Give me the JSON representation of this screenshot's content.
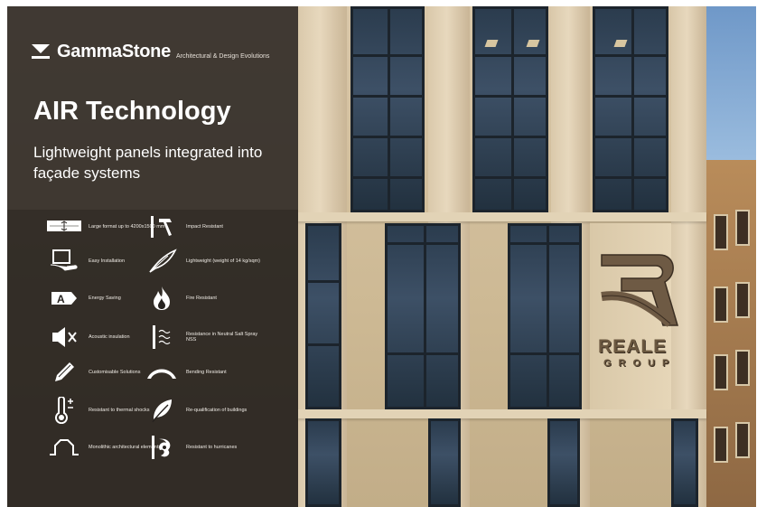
{
  "brand": {
    "name": "GammaStone",
    "tagline": "Architectural & Design Evolutions"
  },
  "headline": {
    "title": "AIR Technology",
    "subtitle": "Lightweight panels integrated into façade systems"
  },
  "features": [
    {
      "icon": "large-format-icon",
      "label": "Large format up to 4200x1500 mm"
    },
    {
      "icon": "hammer-icon",
      "label": "Impact Resistant"
    },
    {
      "icon": "laptop-hand-icon",
      "label": "Easy Installation"
    },
    {
      "icon": "feather-icon",
      "label": "Lightweight (weight of 14 kg/sqm)"
    },
    {
      "icon": "energy-a-icon",
      "label": "Energy Saving"
    },
    {
      "icon": "fire-icon",
      "label": "Fire Resistant"
    },
    {
      "icon": "speaker-mute-icon",
      "label": "Acoustic insulation"
    },
    {
      "icon": "salt-spray-icon",
      "label": "Resistance in Neutral Salt Spray NSS"
    },
    {
      "icon": "pencil-icon",
      "label": "Customisable Solutions"
    },
    {
      "icon": "bending-icon",
      "label": "Bending Resistant"
    },
    {
      "icon": "thermometer-icon",
      "label": "Resistant to thermal shocks"
    },
    {
      "icon": "leaf-icon",
      "label": "Re-qualification of buildings"
    },
    {
      "icon": "monolithic-icon",
      "label": "Monolithic architectural elements"
    },
    {
      "icon": "hurricane-icon",
      "label": "Resistant to hurricanes"
    }
  ],
  "photo_sign": {
    "main": "REALE",
    "sub": "GROUP"
  }
}
